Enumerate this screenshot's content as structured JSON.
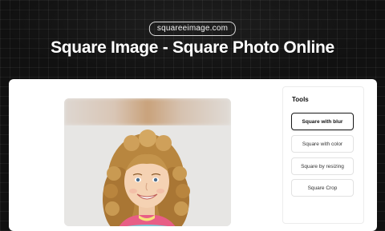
{
  "header": {
    "domain_badge": "squareeimage.com",
    "title": "Square Image - Square Photo Online"
  },
  "tools": {
    "heading": "Tools",
    "items": [
      {
        "label": "Square with blur",
        "active": true
      },
      {
        "label": "Square with color",
        "active": false
      },
      {
        "label": "Square by resizing",
        "active": false
      },
      {
        "label": "Square Crop",
        "active": false
      }
    ]
  }
}
